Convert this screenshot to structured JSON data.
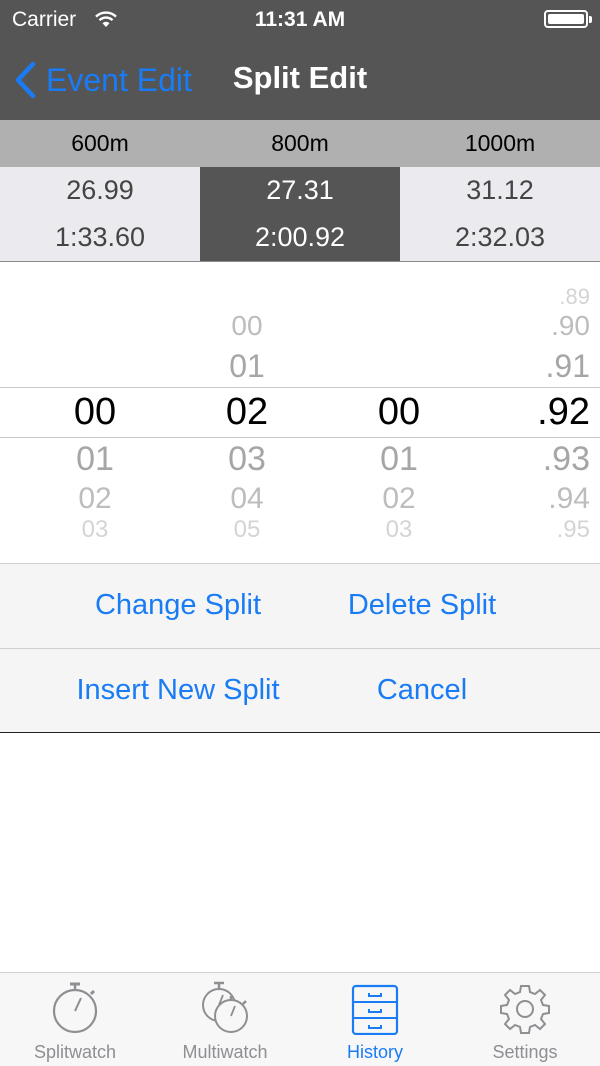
{
  "status_bar": {
    "carrier": "Carrier",
    "time": "11:31 AM"
  },
  "nav": {
    "back_label": "Event Edit",
    "title": "Split Edit"
  },
  "splits": [
    {
      "distance": "600m",
      "split": "26.99",
      "total": "1:33.60",
      "selected": false
    },
    {
      "distance": "800m",
      "split": "27.31",
      "total": "2:00.92",
      "selected": true
    },
    {
      "distance": "1000m",
      "split": "31.12",
      "total": "2:32.03",
      "selected": false
    }
  ],
  "picker": {
    "wheel1": {
      "before": [
        "",
        ""
      ],
      "selected": "00",
      "after": [
        "01",
        "02",
        "03"
      ]
    },
    "wheel2": {
      "before": [
        "00",
        "01"
      ],
      "selected": "02",
      "after": [
        "03",
        "04",
        "05"
      ]
    },
    "wheel3": {
      "before": [
        "",
        ""
      ],
      "selected": "00",
      "after": [
        "01",
        "02",
        "03"
      ]
    },
    "wheel4": {
      "before": [
        ".89",
        ".90",
        ".91"
      ],
      "selected": ".92",
      "after": [
        ".93",
        ".94",
        ".95"
      ]
    }
  },
  "actions": {
    "change_split": "Change Split",
    "delete_split": "Delete Split",
    "insert_new_split": "Insert New Split",
    "cancel": "Cancel"
  },
  "tabs": [
    {
      "label": "Splitwatch",
      "icon": "stopwatch-icon",
      "active": false
    },
    {
      "label": "Multiwatch",
      "icon": "multi-stopwatch-icon",
      "active": false
    },
    {
      "label": "History",
      "icon": "file-cabinet-icon",
      "active": true
    },
    {
      "label": "Settings",
      "icon": "gear-icon",
      "active": false
    }
  ],
  "colors": {
    "accent": "#1a7cf5",
    "bar": "#555555",
    "header": "#b0b0b0"
  }
}
